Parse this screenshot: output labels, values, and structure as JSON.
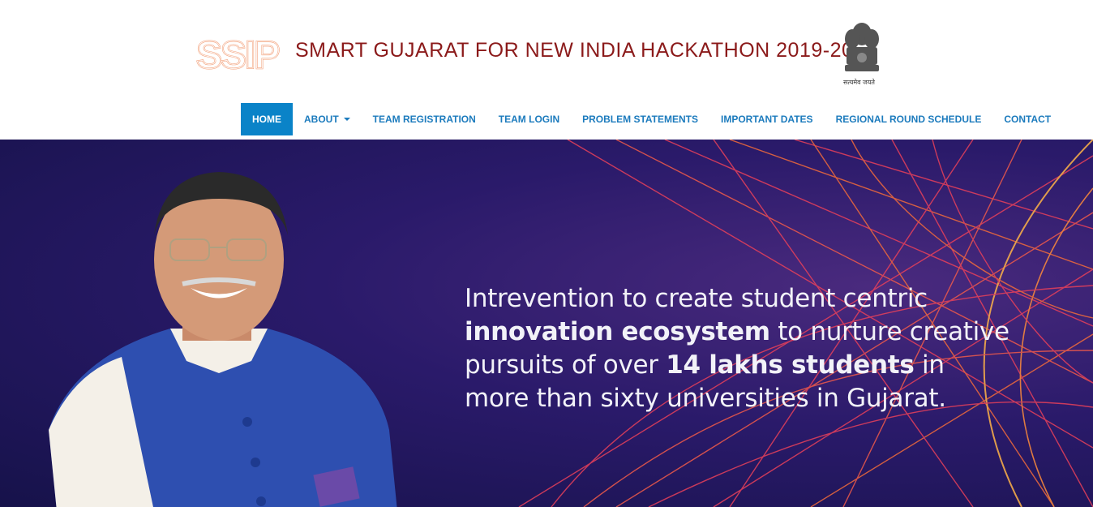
{
  "header": {
    "logo_text": "SSIP",
    "title": "SMART GUJARAT FOR NEW INDIA HACKATHON 2019-20",
    "emblem_caption": "सत्यमेव जयते"
  },
  "nav": {
    "items": [
      {
        "label": "HOME",
        "active": true
      },
      {
        "label": "ABOUT",
        "dropdown": true
      },
      {
        "label": "TEAM REGISTRATION"
      },
      {
        "label": "TEAM LOGIN"
      },
      {
        "label": "PROBLEM STATEMENTS"
      },
      {
        "label": "IMPORTANT DATES"
      },
      {
        "label": "REGIONAL ROUND SCHEDULE"
      },
      {
        "label": "CONTACT"
      }
    ]
  },
  "hero": {
    "line1": "Intrevention to create student centric",
    "line2_bold": "innovation ecosystem",
    "line2_rest": " to nurture creative",
    "line3_pre": "pursuits of over ",
    "line3_bold": "14 lakhs students",
    "line3_post": " in",
    "line4": "more than sixty universities in Gujarat."
  },
  "colors": {
    "title": "#8b1a1a",
    "nav_text": "#1c7bbd",
    "nav_active_bg": "#0a83c8",
    "hero_bg": "#2a1a6a",
    "logo": "#f2a07a"
  }
}
